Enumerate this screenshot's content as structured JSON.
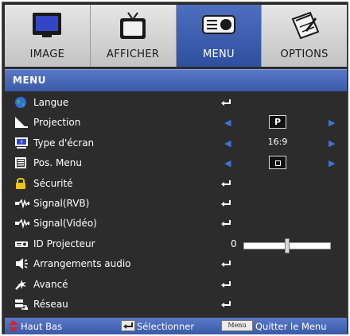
{
  "tabs": [
    {
      "label": "IMAGE",
      "icon": "monitor-icon",
      "active": false
    },
    {
      "label": "AFFICHER",
      "icon": "tv-icon",
      "active": false
    },
    {
      "label": "MENU",
      "icon": "projector-icon",
      "active": true
    },
    {
      "label": "OPTIONS",
      "icon": "notepad-icon",
      "active": false
    }
  ],
  "title": "MENU",
  "rows": [
    {
      "label": "Langue",
      "icon": "globe-icon",
      "control": "enter"
    },
    {
      "label": "Projection",
      "icon": "projection-icon",
      "control": "select",
      "value": "P"
    },
    {
      "label": "Type d'écran",
      "icon": "screen-type-icon",
      "control": "select",
      "value": "16:9"
    },
    {
      "label": "Pos. Menu",
      "icon": "menu-position-icon",
      "control": "select",
      "value": ""
    },
    {
      "label": "Sécurité",
      "icon": "lock-icon",
      "control": "enter"
    },
    {
      "label": "Signal(RVB)",
      "icon": "signal-icon",
      "control": "enter"
    },
    {
      "label": "Signal(Vidéo)",
      "icon": "signal-icon",
      "control": "enter"
    },
    {
      "label": "ID Projecteur",
      "icon": "projector-id-icon",
      "control": "slider",
      "value": "0",
      "level": 0.5
    },
    {
      "label": "Arrangements audio",
      "icon": "speaker-icon",
      "control": "enter"
    },
    {
      "label": "Avancé",
      "icon": "advanced-icon",
      "control": "enter"
    },
    {
      "label": "Réseau",
      "icon": "network-icon",
      "control": "enter"
    }
  ],
  "footer": {
    "nav_label": "Haut Bas",
    "select_label": "Sélectionner",
    "menu_key": "Menu",
    "exit_label": "Quitter le Menu"
  },
  "colors": {
    "accent": "#3a5aa8",
    "background": "#2c2c2c",
    "arrow": "#3d74d8"
  }
}
